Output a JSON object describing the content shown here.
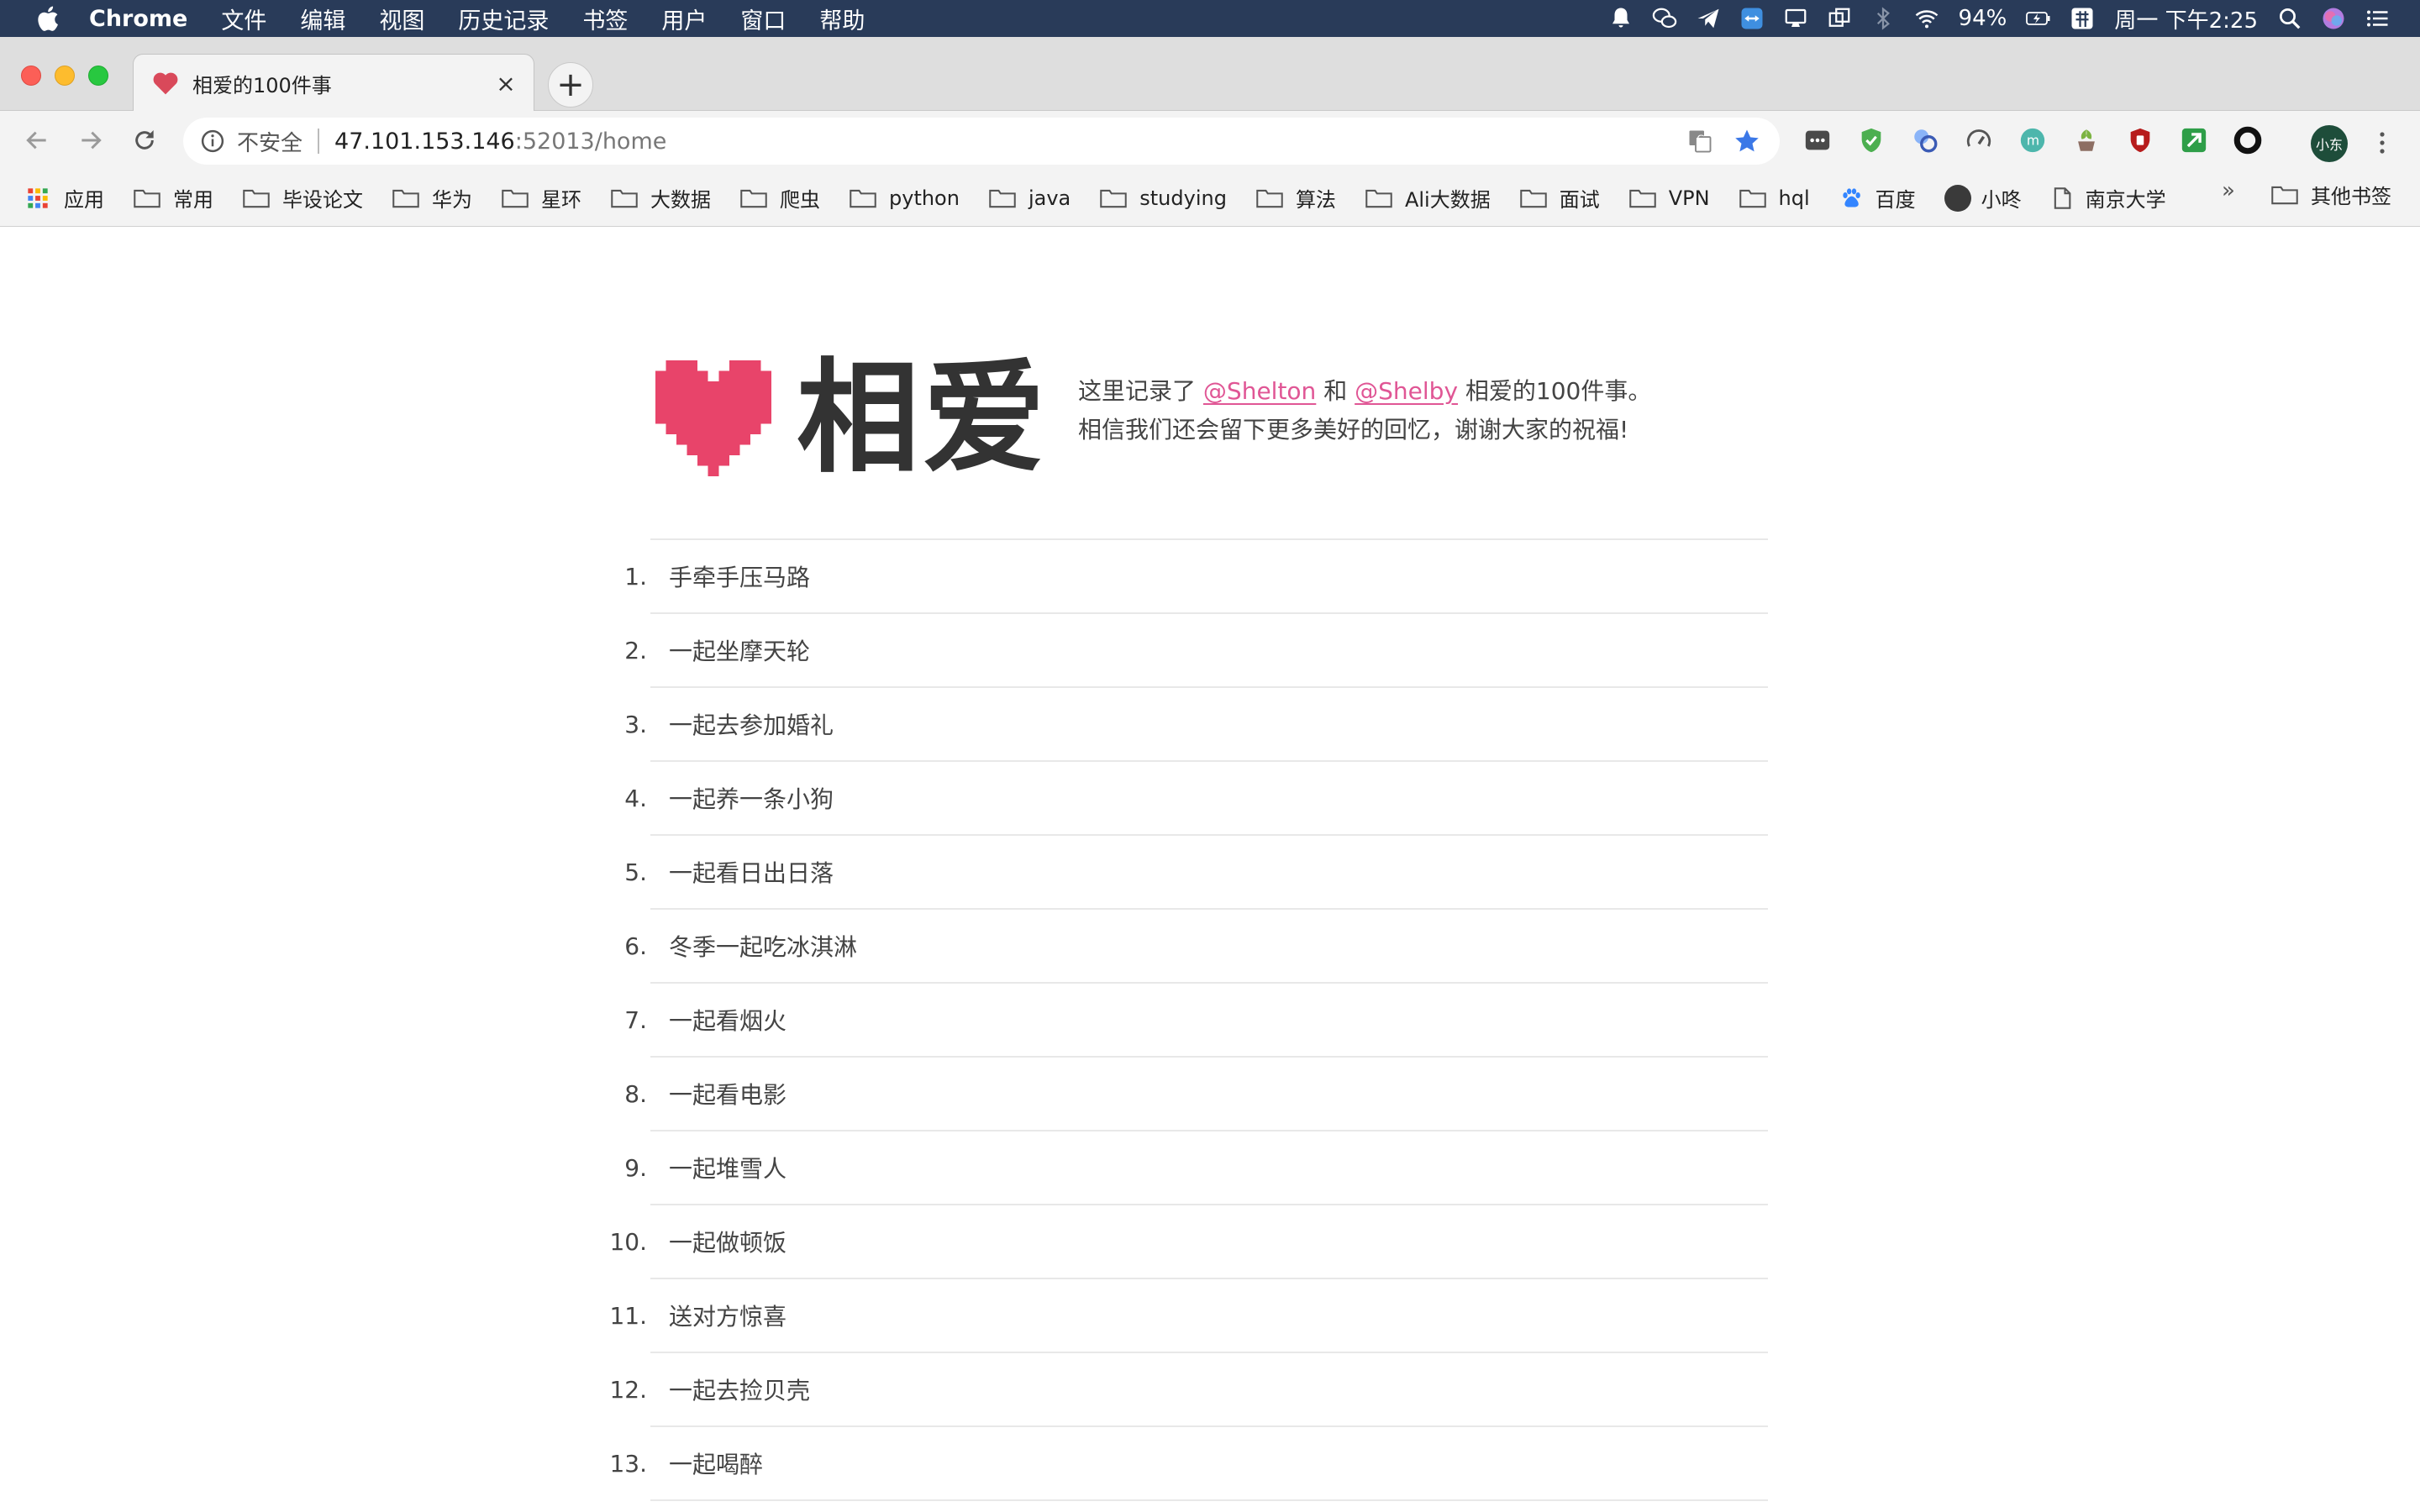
{
  "menubar": {
    "app_name": "Chrome",
    "items": [
      "文件",
      "编辑",
      "视图",
      "历史记录",
      "书签",
      "用户",
      "窗口",
      "帮助"
    ],
    "battery": "94%",
    "datetime": "周一 下午2:25"
  },
  "tab": {
    "title": "相爱的100件事",
    "close": "×",
    "new_tab": "+"
  },
  "address_bar": {
    "security": "不安全",
    "host": "47.101.153.146",
    "path": ":52013/home"
  },
  "profile": {
    "label": "小东"
  },
  "bookmarks": {
    "items": [
      "应用",
      "常用",
      "毕设论文",
      "华为",
      "星环",
      "大数据",
      "爬虫",
      "python",
      "java",
      "studying",
      "算法",
      "Ali大数据",
      "面试",
      "VPN",
      "hql",
      "百度",
      "小咚",
      "南京大学"
    ],
    "more": "»",
    "other": "其他书签"
  },
  "page": {
    "title": "相爱",
    "intro_prefix": "这里记录了",
    "person1": "@Shelton",
    "connector": "和",
    "person2": "@Shelby",
    "intro_suffix": "相爱的100件事。",
    "intro_line2": "相信我们还会留下更多美好的回忆，谢谢大家的祝福!",
    "heart_color": "#e8446a",
    "link_color": "#e05695",
    "items": [
      {
        "num": "1.",
        "text": "手牵手压马路"
      },
      {
        "num": "2.",
        "text": "一起坐摩天轮"
      },
      {
        "num": "3.",
        "text": "一起去参加婚礼"
      },
      {
        "num": "4.",
        "text": "一起养一条小狗"
      },
      {
        "num": "5.",
        "text": "一起看日出日落"
      },
      {
        "num": "6.",
        "text": "冬季一起吃冰淇淋"
      },
      {
        "num": "7.",
        "text": "一起看烟火"
      },
      {
        "num": "8.",
        "text": "一起看电影"
      },
      {
        "num": "9.",
        "text": "一起堆雪人"
      },
      {
        "num": "10.",
        "text": "一起做顿饭"
      },
      {
        "num": "11.",
        "text": "送对方惊喜"
      },
      {
        "num": "12.",
        "text": "一起去捡贝壳"
      },
      {
        "num": "13.",
        "text": "一起喝醉"
      }
    ]
  }
}
